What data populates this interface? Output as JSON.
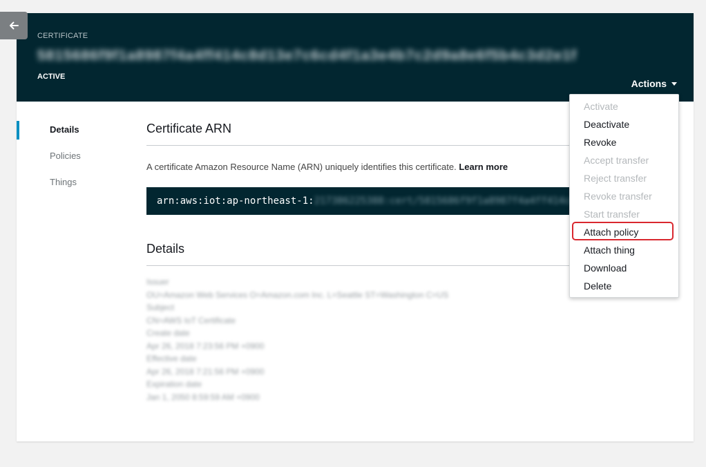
{
  "header": {
    "label": "CERTIFICATE",
    "title": "5815686f9f1a8987f4a4ff414c8d13e7c6cd4f1a3e4b7c2d9a8e6f5b4c3d2e1f",
    "status": "ACTIVE",
    "actions_label": "Actions"
  },
  "nav": {
    "items": [
      {
        "label": "Details"
      },
      {
        "label": "Policies"
      },
      {
        "label": "Things"
      }
    ]
  },
  "arn_section": {
    "title": "Certificate ARN",
    "description": "A certificate Amazon Resource Name (ARN) uniquely identifies this certificate.",
    "learn_more": "Learn more",
    "arn_prefix": "arn:aws:iot:ap-northeast-1:",
    "arn_rest": "217386225388:cert/5815686f9f1a8987f4a4ff414c8d"
  },
  "details_section": {
    "title": "Details",
    "lines": [
      "Issuer",
      "OU=Amazon Web Services O=Amazon.com Inc. L=Seattle ST=Washington C=US",
      "Subject",
      "CN=AWS IoT Certificate",
      "Create date",
      "Apr 26, 2018 7:23:56 PM +0900",
      "Effective date",
      "Apr 26, 2018 7:21:56 PM +0900",
      "Expiration date",
      "Jan 1, 2050 8:59:59 AM +0900"
    ]
  },
  "actions_menu": {
    "items": [
      {
        "label": "Activate",
        "enabled": false
      },
      {
        "label": "Deactivate",
        "enabled": true
      },
      {
        "label": "Revoke",
        "enabled": true
      },
      {
        "label": "Accept transfer",
        "enabled": false
      },
      {
        "label": "Reject transfer",
        "enabled": false
      },
      {
        "label": "Revoke transfer",
        "enabled": false
      },
      {
        "label": "Start transfer",
        "enabled": false
      },
      {
        "label": "Attach policy",
        "enabled": true
      },
      {
        "label": "Attach thing",
        "enabled": true
      },
      {
        "label": "Download",
        "enabled": true
      },
      {
        "label": "Delete",
        "enabled": true
      }
    ]
  },
  "colors": {
    "header_bg": "#022630",
    "accent": "#0a8fc1",
    "highlight": "#d9272e"
  }
}
